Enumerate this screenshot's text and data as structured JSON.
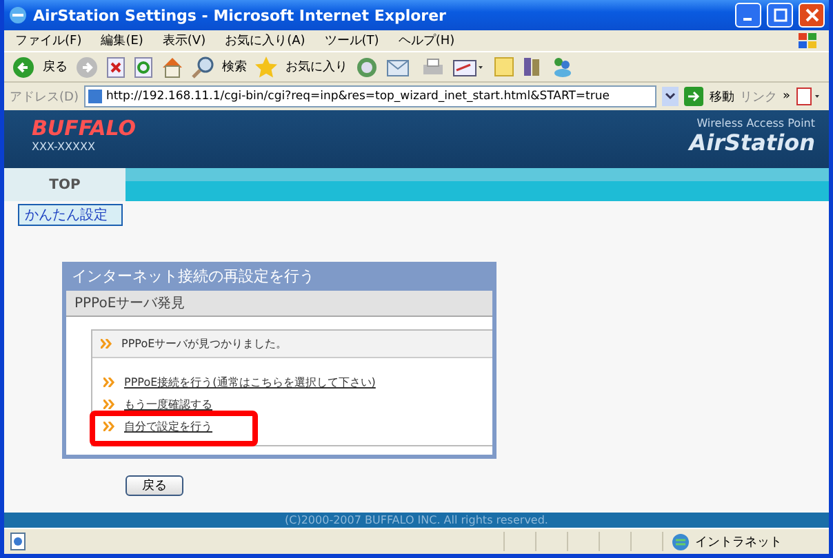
{
  "window": {
    "title": "AirStation Settings - Microsoft Internet Explorer"
  },
  "menu": [
    "ファイル(F)",
    "編集(E)",
    "表示(V)",
    "お気に入り(A)",
    "ツール(T)",
    "ヘルプ(H)"
  ],
  "toolbar": {
    "back": "戻る",
    "search": "検索",
    "favorites": "お気に入り"
  },
  "address": {
    "label": "アドレス(D)",
    "url": "http://192.168.11.1/cgi-bin/cgi?req=inp&res=top_wizard_inet_start.html&START=true",
    "go": "移動",
    "links": "リンク",
    "more": "»"
  },
  "header": {
    "brand": "BUFFALO",
    "model": "XXX-XXXXX",
    "tagline": "Wireless Access Point",
    "product": "AirStation"
  },
  "nav": {
    "tab": "TOP",
    "link": "かんたん設定"
  },
  "panel": {
    "title": "インターネット接続の再設定を行う",
    "subtitle": "PPPoEサーバ発見",
    "message": "PPPoEサーバが見つかりました。",
    "options": [
      {
        "label": "PPPoE接続を行う(通常はこちらを選択して下さい)",
        "highlighted": false
      },
      {
        "label": "もう一度確認する",
        "highlighted": false
      },
      {
        "label": "自分で設定を行う",
        "highlighted": true
      }
    ]
  },
  "back_button": "戻る",
  "footer": "(C)2000-2007 BUFFALO INC. All rights reserved.",
  "status_bar": {
    "zone": "イントラネット"
  }
}
